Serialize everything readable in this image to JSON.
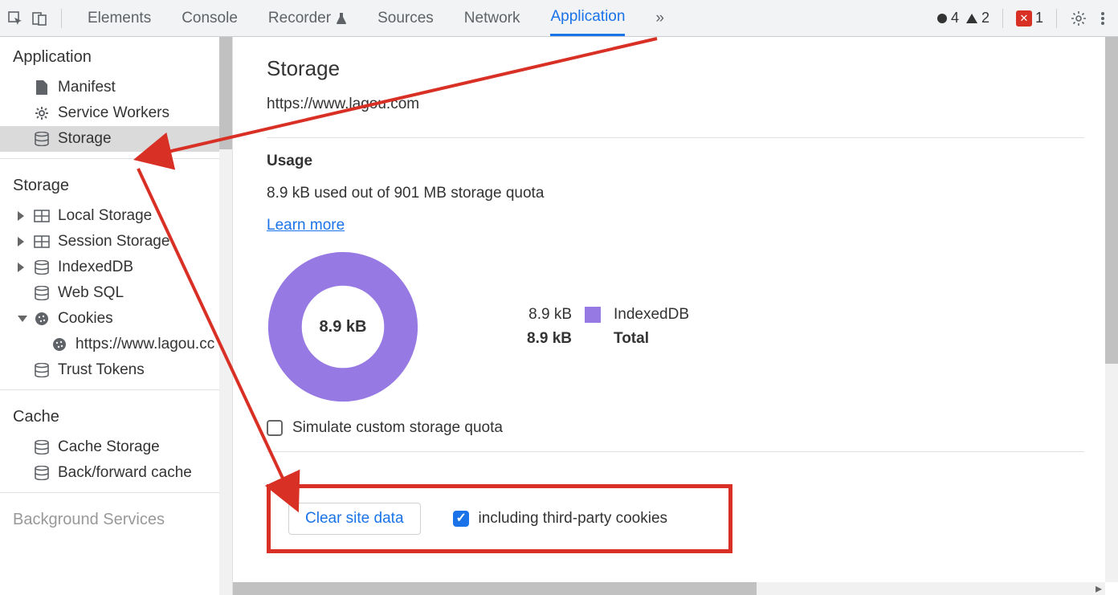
{
  "toolbar": {
    "tabs": [
      "Elements",
      "Console",
      "Recorder",
      "Sources",
      "Network",
      "Application"
    ],
    "active_tab": "Application",
    "log_count": "4",
    "warn_count": "2",
    "error_count": "1"
  },
  "sidebar": {
    "sections": {
      "application": {
        "title": "Application",
        "items": {
          "manifest": "Manifest",
          "service_workers": "Service Workers",
          "storage": "Storage"
        }
      },
      "storage": {
        "title": "Storage",
        "items": {
          "local_storage": "Local Storage",
          "session_storage": "Session Storage",
          "indexeddb": "IndexedDB",
          "web_sql": "Web SQL",
          "cookies": "Cookies",
          "cookie_origin": "https://www.lagou.cc",
          "trust_tokens": "Trust Tokens"
        }
      },
      "cache": {
        "title": "Cache",
        "items": {
          "cache_storage": "Cache Storage",
          "bf_cache": "Back/forward cache"
        }
      },
      "background": {
        "title": "Background Services"
      }
    }
  },
  "content": {
    "title": "Storage",
    "origin": "https://www.lagou.com",
    "usage_heading": "Usage",
    "usage_text": "8.9 kB used out of 901 MB storage quota",
    "learn_more": "Learn more",
    "simulate_label": "Simulate custom storage quota",
    "clear_button": "Clear site data",
    "third_party_label": "including third-party cookies",
    "legend": {
      "row1_size": "8.9 kB",
      "row1_label": "IndexedDB",
      "total_size": "8.9 kB",
      "total_label": "Total"
    },
    "donut_center": "8.9 kB"
  },
  "chart_data": {
    "type": "pie",
    "title": "Storage usage",
    "series": [
      {
        "name": "IndexedDB",
        "value_label": "8.9 kB",
        "value_bytes": 8900,
        "color": "#9779e3"
      }
    ],
    "total_label": "8.9 kB",
    "quota_label": "901 MB"
  }
}
